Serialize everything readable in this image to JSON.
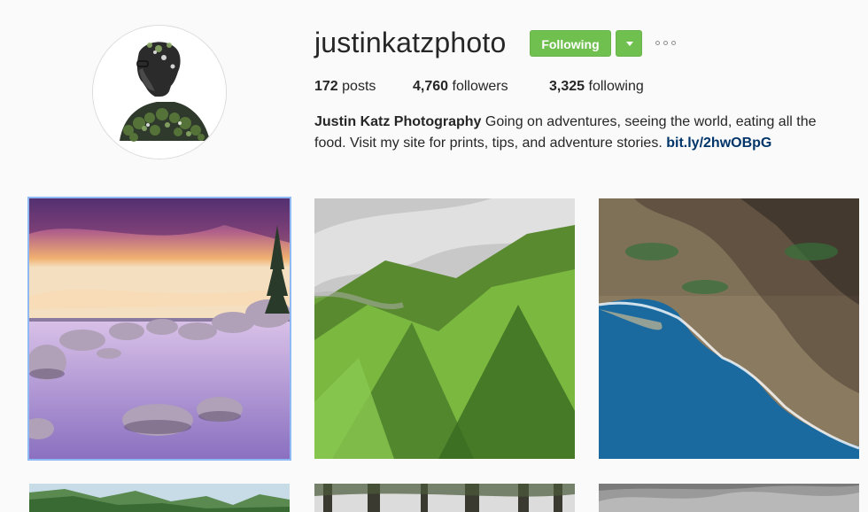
{
  "profile": {
    "username": "justinkatzphoto",
    "follow_button_label": "Following",
    "stats": {
      "posts_count": "172",
      "posts_label": "posts",
      "followers_count": "4,760",
      "followers_label": "followers",
      "following_count": "3,325",
      "following_label": "following"
    },
    "bio": {
      "name": "Justin Katz Photography",
      "text": "Going on adventures, seeing the world, eating all the food. Visit my site for prints, tips, and adventure stories.",
      "link": "bit.ly/2hwOBpG"
    }
  },
  "icons": {
    "follow_dropdown": "caret-down-icon",
    "more_options": "ellipsis-icon"
  },
  "colors": {
    "follow_green": "#70c050",
    "link_blue": "#003569",
    "selected_outline": "#8fb9f4",
    "background": "#fafafa"
  },
  "posts": [
    {
      "subject": "lake shore with boulders at sunset",
      "selected": true
    },
    {
      "subject": "green mountain ridges"
    },
    {
      "subject": "coastal cliffs and ocean from above"
    },
    {
      "subject": "green coastal mountains"
    },
    {
      "subject": "forest trees"
    },
    {
      "subject": "cloudy grey sky"
    }
  ]
}
